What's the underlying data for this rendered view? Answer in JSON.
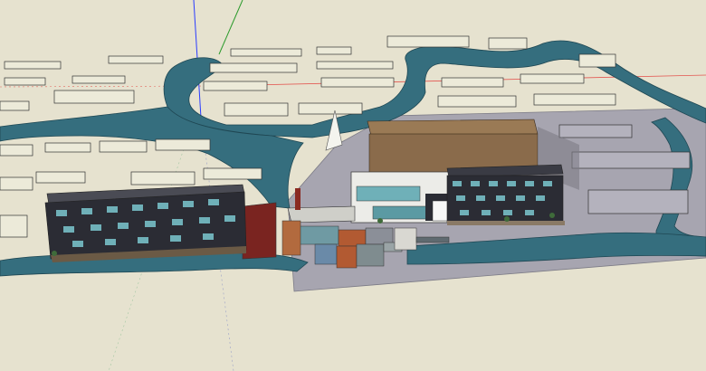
{
  "image": {
    "kind": "3d-architectural-model-viewport",
    "colors": {
      "ground": "#e6e2cf",
      "water": "#356e7e",
      "plaza": "#a7a5b0",
      "roof": "#8a6b4b",
      "axis_red": "#e21b1b",
      "axis_green": "#2b9a2b",
      "axis_blue": "#2a3cff",
      "facade_dark": "#2b2c34",
      "glass": "#6fb0b8"
    }
  }
}
